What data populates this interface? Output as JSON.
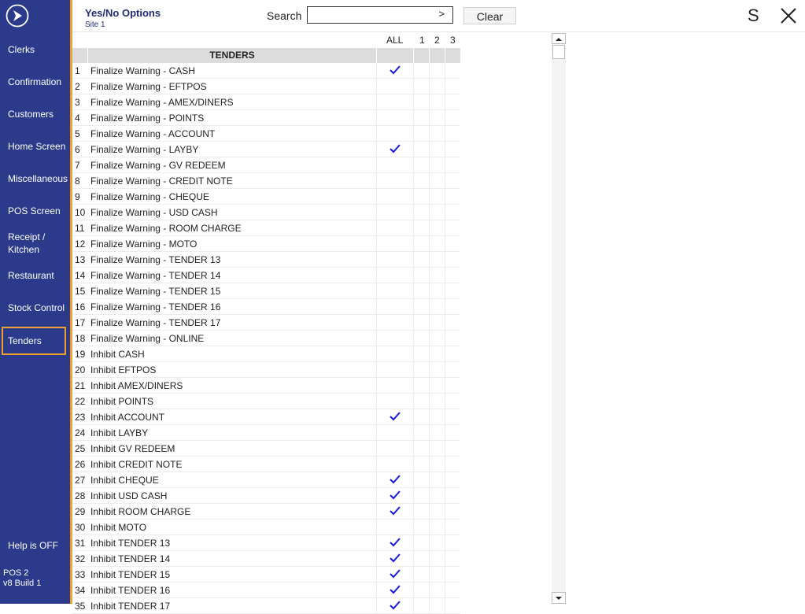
{
  "sidebar": {
    "items": [
      {
        "label": "Clerks",
        "active": false
      },
      {
        "label": "Confirmation",
        "active": false
      },
      {
        "label": "Customers",
        "active": false
      },
      {
        "label": "Home Screen",
        "active": false
      },
      {
        "label": "Miscellaneous",
        "active": false
      },
      {
        "label": "POS Screen",
        "active": false
      },
      {
        "label": "Receipt / Kitchen",
        "active": false
      },
      {
        "label": "Restaurant",
        "active": false
      },
      {
        "label": "Stock Control",
        "active": false
      },
      {
        "label": "Tenders",
        "active": true
      }
    ],
    "help": "Help is OFF",
    "version_line1": "POS 2",
    "version_line2": "v8 Build 1"
  },
  "header": {
    "title": "Yes/No Options",
    "subtitle": "Site 1",
    "search_label": "Search",
    "search_value": "",
    "search_go": ">",
    "clear_label": "Clear",
    "s_label": "S"
  },
  "columns": [
    "ALL",
    "1",
    "2",
    "3"
  ],
  "section_title": "TENDERS",
  "rows": [
    {
      "num": "1",
      "label": "Finalize Warning - CASH",
      "all": true
    },
    {
      "num": "2",
      "label": "Finalize Warning - EFTPOS",
      "all": false
    },
    {
      "num": "3",
      "label": "Finalize Warning - AMEX/DINERS",
      "all": false
    },
    {
      "num": "4",
      "label": "Finalize Warning - POINTS",
      "all": false
    },
    {
      "num": "5",
      "label": "Finalize Warning - ACCOUNT",
      "all": false
    },
    {
      "num": "6",
      "label": "Finalize Warning - LAYBY",
      "all": true
    },
    {
      "num": "7",
      "label": "Finalize Warning - GV REDEEM",
      "all": false
    },
    {
      "num": "8",
      "label": "Finalize Warning - CREDIT NOTE",
      "all": false
    },
    {
      "num": "9",
      "label": "Finalize Warning - CHEQUE",
      "all": false
    },
    {
      "num": "10",
      "label": "Finalize Warning - USD CASH",
      "all": false
    },
    {
      "num": "11",
      "label": "Finalize Warning - ROOM CHARGE",
      "all": false
    },
    {
      "num": "12",
      "label": "Finalize Warning - MOTO",
      "all": false
    },
    {
      "num": "13",
      "label": "Finalize Warning - TENDER 13",
      "all": false
    },
    {
      "num": "14",
      "label": "Finalize Warning - TENDER 14",
      "all": false
    },
    {
      "num": "15",
      "label": "Finalize Warning - TENDER 15",
      "all": false
    },
    {
      "num": "16",
      "label": "Finalize Warning - TENDER 16",
      "all": false
    },
    {
      "num": "17",
      "label": "Finalize Warning - TENDER 17",
      "all": false
    },
    {
      "num": "18",
      "label": "Finalize Warning - ONLINE",
      "all": false
    },
    {
      "num": "19",
      "label": "Inhibit CASH",
      "all": false
    },
    {
      "num": "20",
      "label": "Inhibit EFTPOS",
      "all": false
    },
    {
      "num": "21",
      "label": "Inhibit AMEX/DINERS",
      "all": false
    },
    {
      "num": "22",
      "label": "Inhibit POINTS",
      "all": false
    },
    {
      "num": "23",
      "label": "Inhibit ACCOUNT",
      "all": true
    },
    {
      "num": "24",
      "label": "Inhibit LAYBY",
      "all": false
    },
    {
      "num": "25",
      "label": "Inhibit GV REDEEM",
      "all": false
    },
    {
      "num": "26",
      "label": "Inhibit CREDIT NOTE",
      "all": false
    },
    {
      "num": "27",
      "label": "Inhibit CHEQUE",
      "all": true
    },
    {
      "num": "28",
      "label": "Inhibit USD CASH",
      "all": true
    },
    {
      "num": "29",
      "label": "Inhibit ROOM CHARGE",
      "all": true
    },
    {
      "num": "30",
      "label": "Inhibit MOTO",
      "all": false
    },
    {
      "num": "31",
      "label": "Inhibit TENDER 13",
      "all": true
    },
    {
      "num": "32",
      "label": "Inhibit TENDER 14",
      "all": true
    },
    {
      "num": "33",
      "label": "Inhibit TENDER 15",
      "all": true
    },
    {
      "num": "34",
      "label": "Inhibit TENDER 16",
      "all": true
    },
    {
      "num": "35",
      "label": "Inhibit TENDER 17",
      "all": true
    }
  ],
  "colors": {
    "sidebar_bg": "#2b3a8a",
    "accent": "#f0a030",
    "check": "#1a1adc"
  },
  "icons": {
    "logo": "logo-icon",
    "close": "close-icon",
    "check": "check-icon"
  }
}
